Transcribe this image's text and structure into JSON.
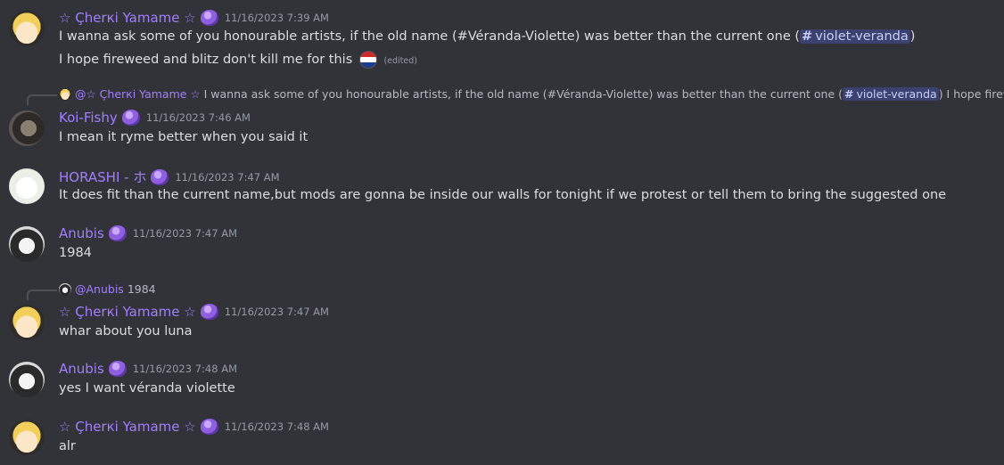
{
  "messages": [
    {
      "author": "☆ Çherкi Yamame ☆",
      "timestamp": "11/16/2023 7:39 AM",
      "line1_before": "I wanna ask some of you honourable artists, if the old name (#Véranda-Violette) was better than the current one (",
      "line1_channel": "violet-veranda",
      "line1_after": ")",
      "line2": "I hope fireweed and blitz don't kill me for this",
      "edited": "(edited)"
    },
    {
      "reply_author": "@☆ Çherкi Yamame ☆",
      "reply_before": "I wanna ask some of you honourable artists, if the old name (#Véranda-Violette) was better than the current one (",
      "reply_channel": "violet-veranda",
      "reply_after": ") I hope fireweed a",
      "author": "Koi-Fishy",
      "timestamp": "11/16/2023 7:46 AM",
      "text": "I mean it ryme better when you said it"
    },
    {
      "author": "HORASHI - ホ",
      "timestamp": "11/16/2023 7:47 AM",
      "text": "It does fit than the current name,but mods are gonna be inside our walls for tonight if we protest or tell them to bring the suggested one"
    },
    {
      "author": "Anubis",
      "timestamp": "11/16/2023 7:47 AM",
      "text": "1984"
    },
    {
      "reply_author": "@Anubis",
      "reply_text": "1984",
      "author": "☆ Çherкi Yamame ☆",
      "timestamp": "11/16/2023 7:47 AM",
      "text": "whar about you luna"
    },
    {
      "author": "Anubis",
      "timestamp": "11/16/2023 7:48 AM",
      "text": "yes I want véranda violette"
    },
    {
      "author": "☆ Çherкi Yamame ☆",
      "timestamp": "11/16/2023 7:48 AM",
      "text": "alr"
    }
  ],
  "icons": {
    "channel": "#",
    "badge": "purple-slime-badge-icon",
    "flag": "flag-emoji"
  },
  "colors": {
    "background": "#313338",
    "username": "#a37eff",
    "mention_bg": "#3c4270",
    "timestamp": "#949ba4"
  }
}
